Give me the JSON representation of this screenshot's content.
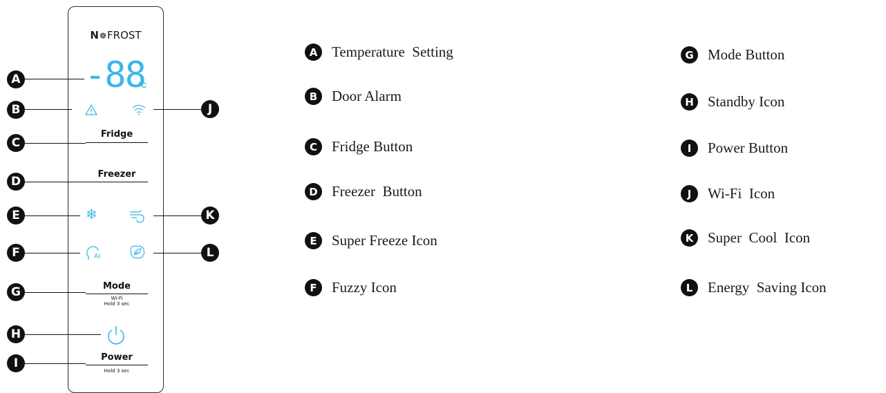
{
  "panel": {
    "brand_prefix": "N",
    "brand_o": "❁",
    "brand_suffix": "FROST",
    "temperature_display": "-88",
    "temperature_unit": "°C",
    "buttons": {
      "fridge": "Fridge",
      "freezer": "Freezer",
      "mode": "Mode",
      "mode_sub_1": "Wi-Fi",
      "mode_sub_2": "Hold 3 sec",
      "power": "Power",
      "power_sub": "Hold 3 sec"
    },
    "icons": {
      "door_alarm": "alert-triangle-icon",
      "wifi": "wifi-icon",
      "super_freeze": "snowflake-icon",
      "super_cool": "wind-icon",
      "fuzzy": "ai-head-icon",
      "energy_saving": "leaf-icon",
      "standby": "power-icon"
    },
    "accent_color": "#3ab8e8"
  },
  "callouts": [
    "A",
    "B",
    "C",
    "D",
    "E",
    "F",
    "G",
    "H",
    "I",
    "J",
    "K",
    "L"
  ],
  "legend": [
    {
      "letter": "A",
      "text": "Temperature  Setting"
    },
    {
      "letter": "B",
      "text": "Door Alarm"
    },
    {
      "letter": "C",
      "text": "Fridge Button"
    },
    {
      "letter": "D",
      "text": "Freezer  Button"
    },
    {
      "letter": "E",
      "text": "Super Freeze Icon"
    },
    {
      "letter": "F",
      "text": "Fuzzy Icon"
    },
    {
      "letter": "G",
      "text": "Mode Button"
    },
    {
      "letter": "H",
      "text": "Standby Icon"
    },
    {
      "letter": "I",
      "text": "Power Button"
    },
    {
      "letter": "J",
      "text": "Wi-Fi  Icon"
    },
    {
      "letter": "K",
      "text": "Super  Cool  Icon"
    },
    {
      "letter": "L",
      "text": "Energy  Saving Icon"
    }
  ]
}
